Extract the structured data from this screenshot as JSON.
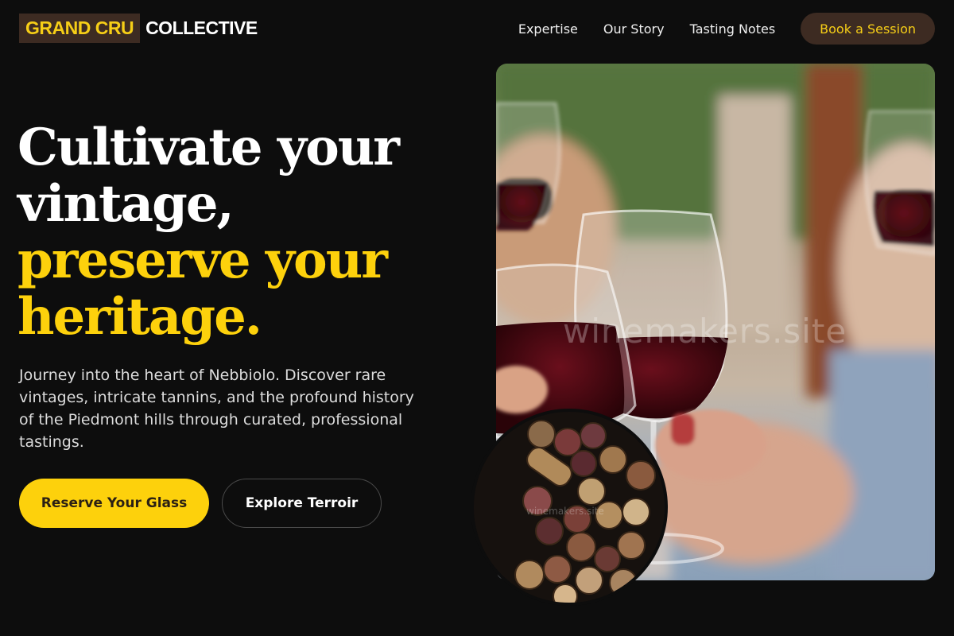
{
  "brand": {
    "mark": "GRAND CRU",
    "word": "COLLECTIVE"
  },
  "nav": {
    "links": [
      "Expertise",
      "Our Story",
      "Tasting Notes"
    ],
    "cta": "Book a Session"
  },
  "hero": {
    "headline_white": [
      "Cultivate your",
      "vintage,"
    ],
    "headline_gold": [
      "preserve your",
      "heritage."
    ],
    "lead": "Journey into the heart of Nebbiolo. Discover rare vintages, intricate tannins, and the profound history of the Piedmont hills through curated, professional tastings.",
    "primary_button": "Reserve Your Glass",
    "secondary_button": "Explore Terroir"
  },
  "images": {
    "main_watermark": "winemakers.site",
    "cork_watermark": "winemakers.site"
  },
  "colors": {
    "background": "#0d0d0d",
    "gold": "#fdd10c",
    "brown": "#3d2b22"
  }
}
